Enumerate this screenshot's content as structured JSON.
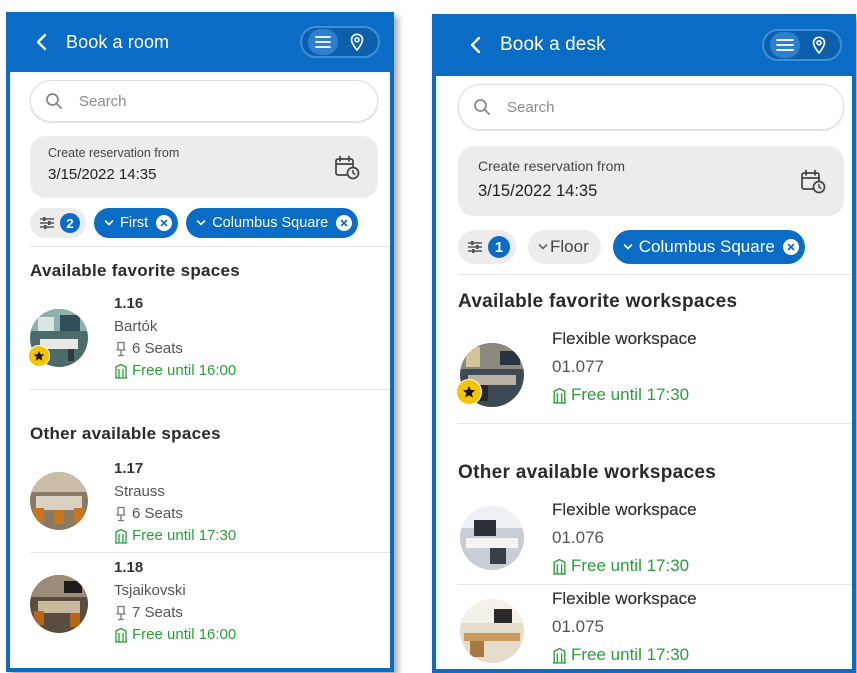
{
  "room": {
    "header": {
      "title": "Book a room"
    },
    "search": {
      "placeholder": "Search"
    },
    "reservation": {
      "label": "Create reservation from",
      "value": "3/15/2022 14:35"
    },
    "filters": {
      "count": "2",
      "chips": [
        "First",
        "Columbus Square"
      ]
    },
    "favorites": {
      "title": "Available favorite spaces",
      "items": [
        {
          "number": "1.16",
          "name": "Bartók",
          "seats": "6 Seats",
          "free": "Free until 16:00"
        }
      ]
    },
    "others": {
      "title": "Other available spaces",
      "items": [
        {
          "number": "1.17",
          "name": "Strauss",
          "seats": "6 Seats",
          "free": "Free until 17:30"
        },
        {
          "number": "1.18",
          "name": "Tsjaikovski",
          "seats": "7 Seats",
          "free": "Free until 16:00"
        }
      ]
    }
  },
  "desk": {
    "header": {
      "title": "Book a desk"
    },
    "search": {
      "placeholder": "Search"
    },
    "reservation": {
      "label": "Create reservation from",
      "value": "3/15/2022 14:35"
    },
    "filters": {
      "count": "1",
      "floor": "Floor",
      "chips": [
        "Columbus Square"
      ]
    },
    "favorites": {
      "title": "Available favorite workspaces",
      "items": [
        {
          "name": "Flexible workspace",
          "code": "01.077",
          "free": "Free until 17:30"
        }
      ]
    },
    "others": {
      "title": "Other available workspaces",
      "items": [
        {
          "name": "Flexible workspace",
          "code": "01.076",
          "free": "Free until 17:30"
        },
        {
          "name": "Flexible workspace",
          "code": "01.075",
          "free": "Free until 17:30"
        }
      ]
    }
  },
  "colors": {
    "primary": "#0a6cc4",
    "free_green": "#2a9d3c",
    "star_yellow": "#f5c400",
    "chip_grey": "#ececec"
  },
  "icons": [
    "back-arrow-icon",
    "list-icon",
    "map-pin-icon",
    "search-icon",
    "calendar-clock-icon",
    "filter-sliders-icon",
    "chevron-down-icon",
    "clear-icon",
    "star-icon",
    "seat-icon",
    "building-icon"
  ]
}
